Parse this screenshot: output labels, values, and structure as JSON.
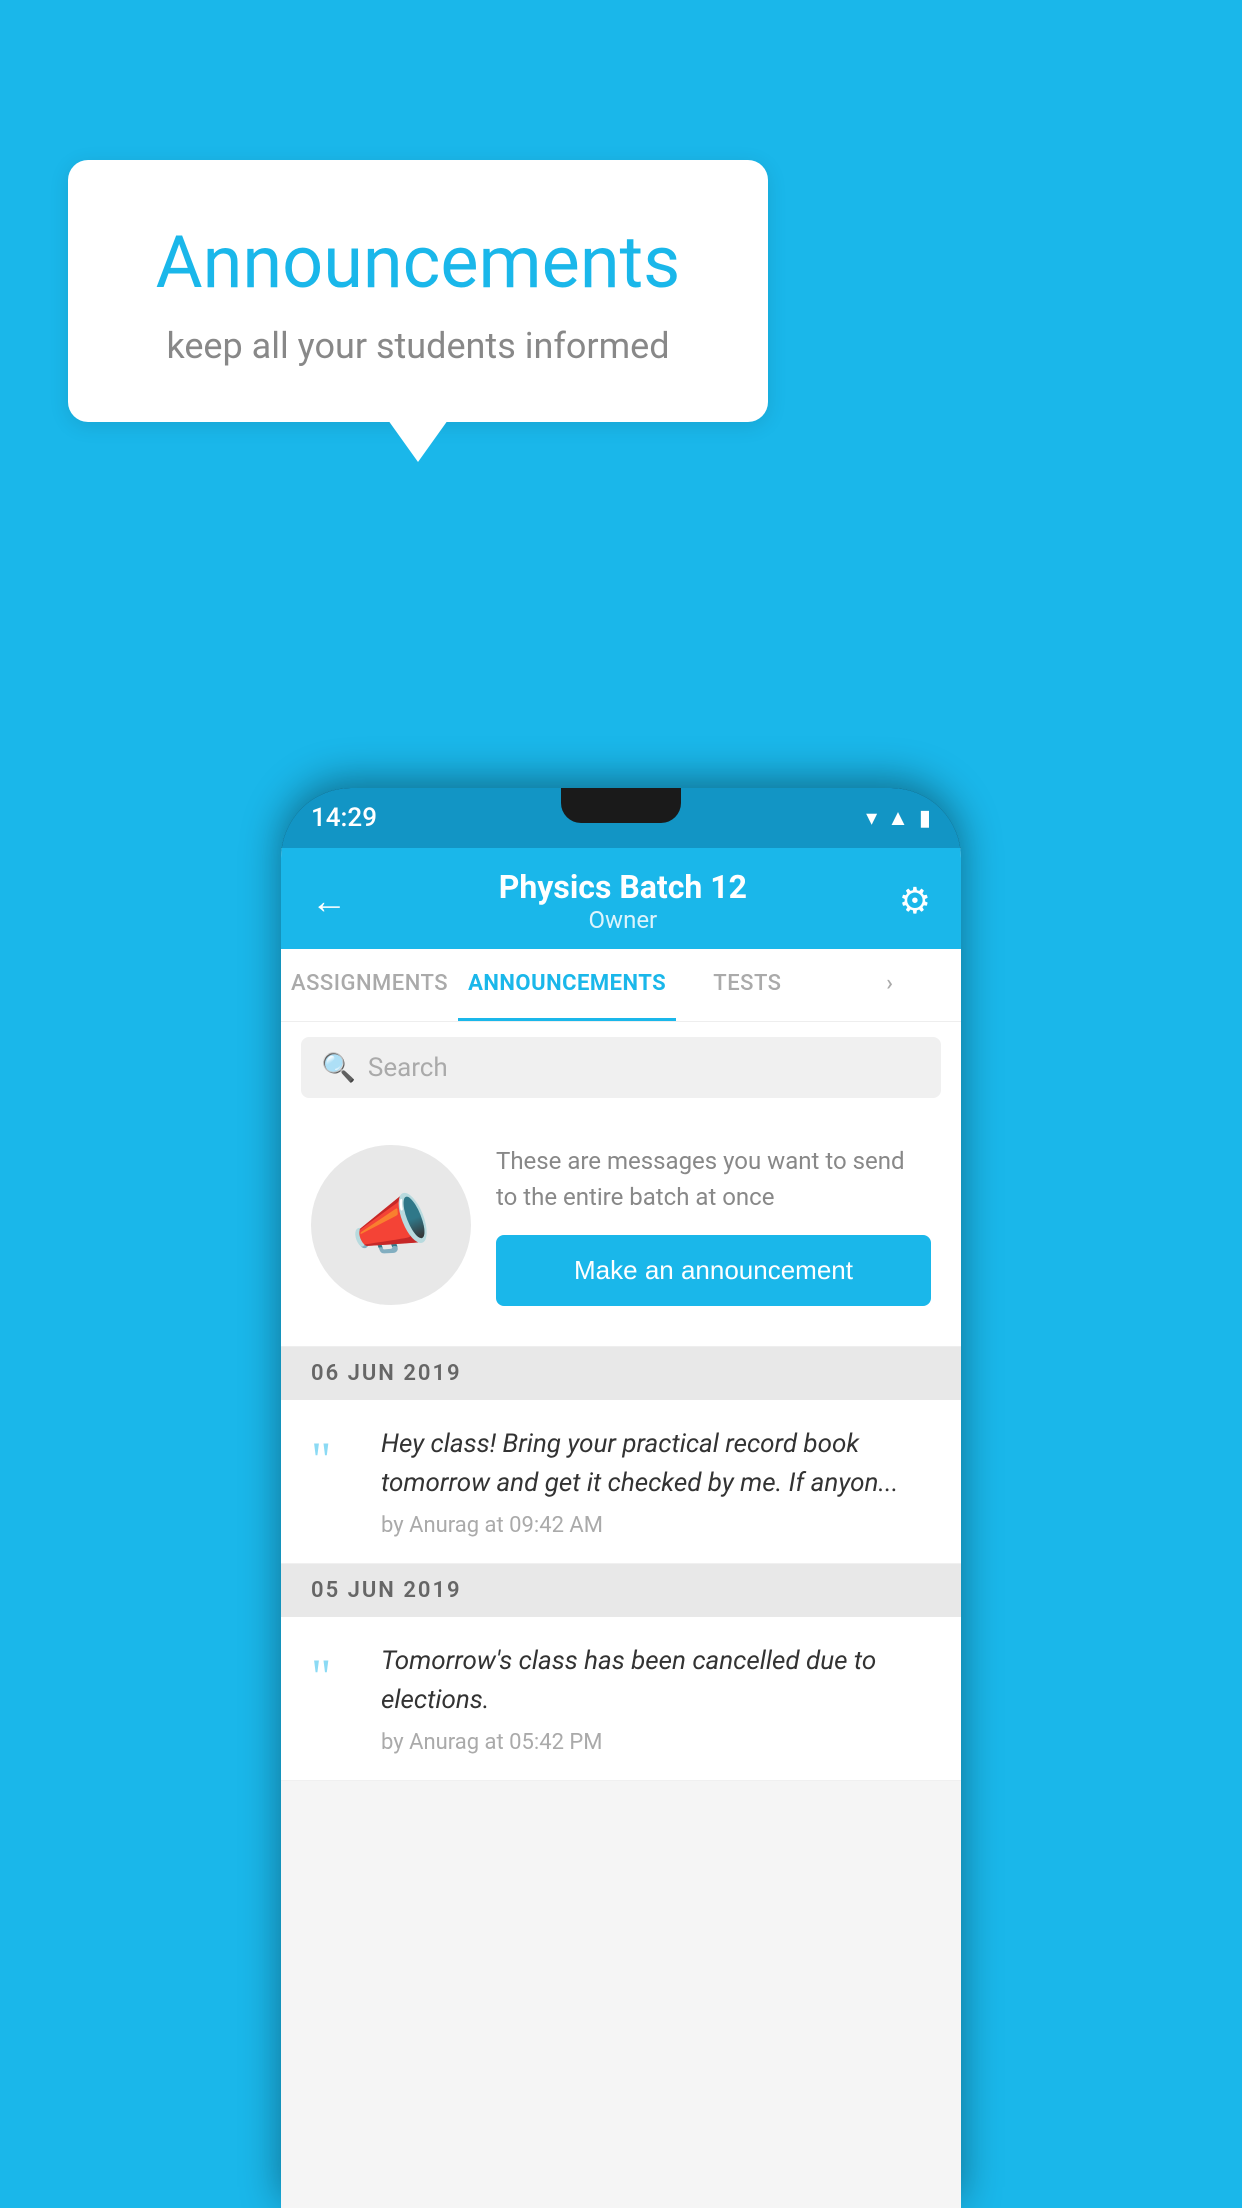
{
  "background_color": "#1ab7ea",
  "speech_bubble": {
    "title": "Announcements",
    "subtitle": "keep all your students informed"
  },
  "phone": {
    "status_bar": {
      "time": "14:29",
      "icons": [
        "wifi",
        "signal",
        "battery"
      ]
    },
    "header": {
      "back_label": "←",
      "title": "Physics Batch 12",
      "subtitle": "Owner",
      "gear_label": "⚙"
    },
    "tabs": [
      {
        "label": "ASSIGNMENTS",
        "active": false
      },
      {
        "label": "ANNOUNCEMENTS",
        "active": true
      },
      {
        "label": "TESTS",
        "active": false
      },
      {
        "label": "›",
        "active": false
      }
    ],
    "search": {
      "placeholder": "Search"
    },
    "cta": {
      "description": "These are messages you want to send to the entire batch at once",
      "button_label": "Make an announcement"
    },
    "announcements": [
      {
        "date": "06  JUN  2019",
        "text": "Hey class! Bring your practical record book tomorrow and get it checked by me. If anyon...",
        "meta": "by Anurag at 09:42 AM"
      },
      {
        "date": "05  JUN  2019",
        "text": "Tomorrow's class has been cancelled due to elections.",
        "meta": "by Anurag at 05:42 PM"
      }
    ]
  }
}
